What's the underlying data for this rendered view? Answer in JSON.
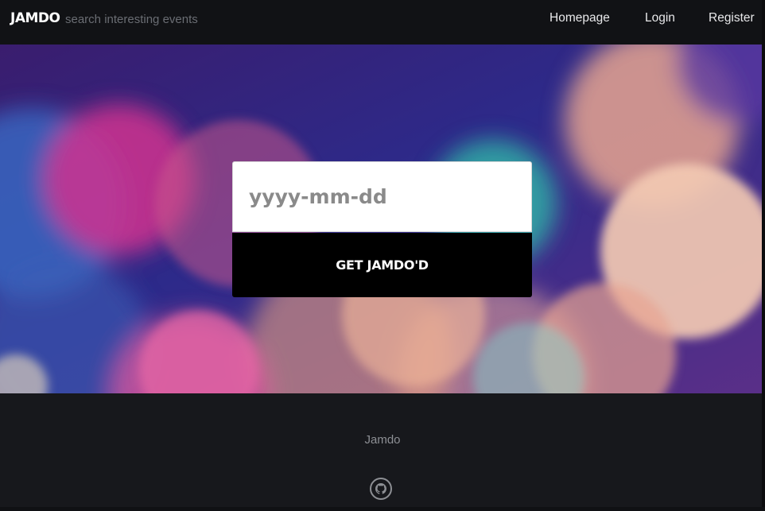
{
  "header": {
    "brand": "JAMDO",
    "tagline": "search interesting events",
    "nav": [
      {
        "label": "Homepage"
      },
      {
        "label": "Login"
      },
      {
        "label": "Register"
      }
    ]
  },
  "search": {
    "date_placeholder": "yyyy-mm-dd",
    "date_value": "",
    "submit_label": "GET JAMDO'D"
  },
  "footer": {
    "text": "Jamdo",
    "icon": "github-icon"
  },
  "colors": {
    "navbar_bg": "#111215",
    "footer_bg": "#17181c",
    "button_bg": "#000000",
    "input_bg": "#ffffff"
  }
}
